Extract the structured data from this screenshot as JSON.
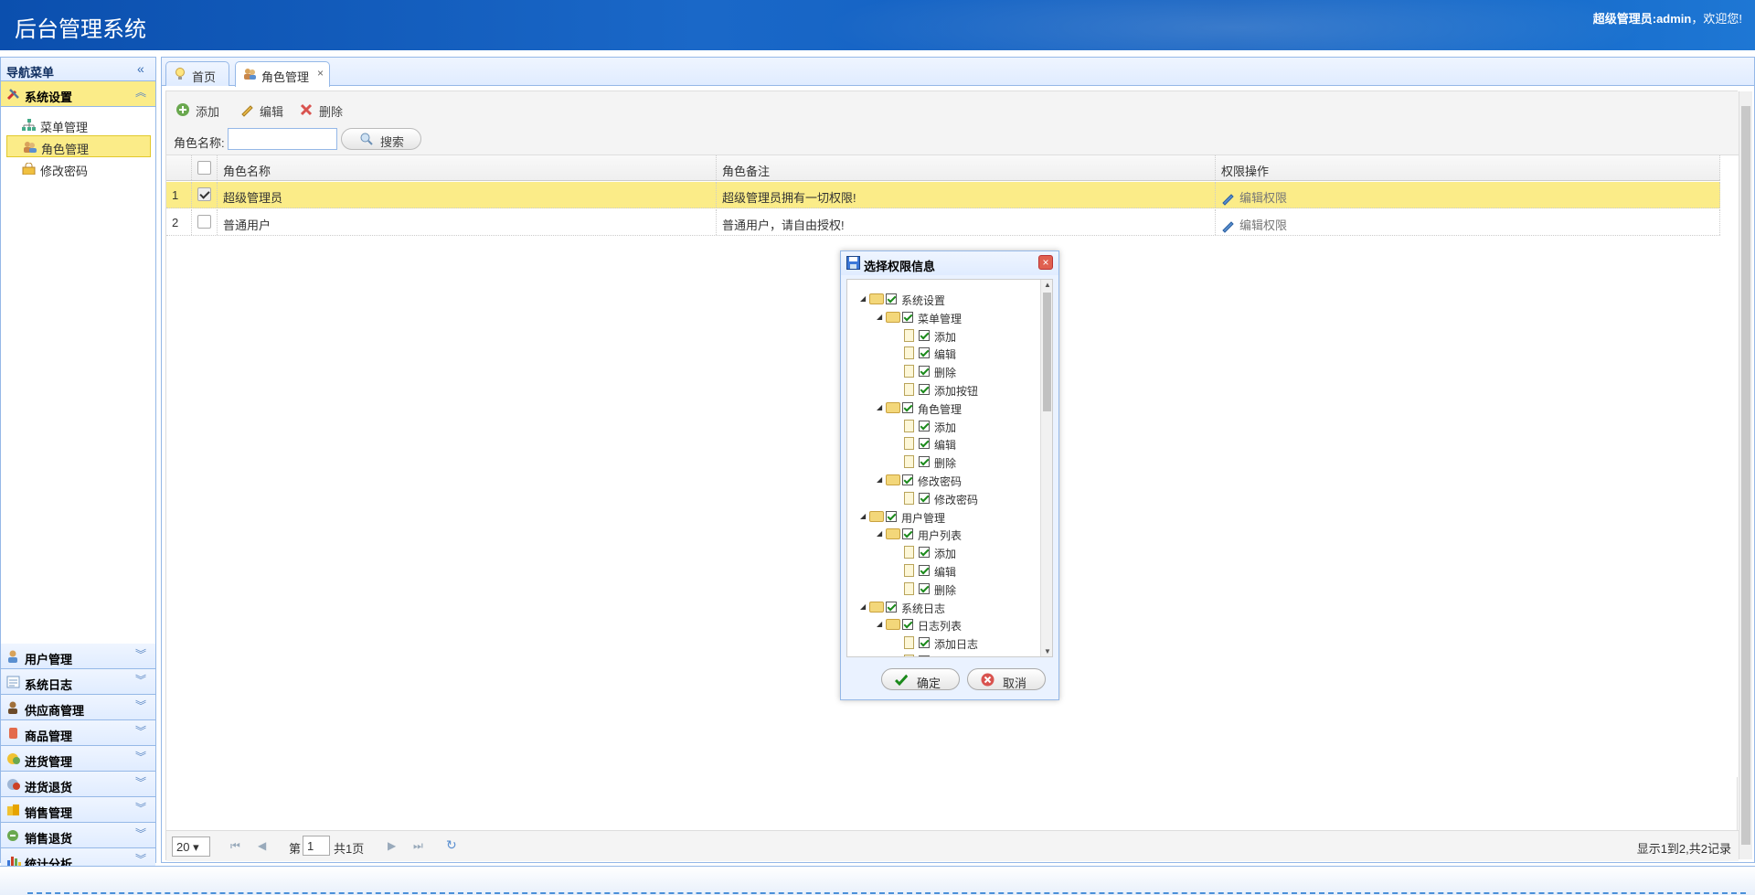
{
  "header": {
    "title": "后台管理系统",
    "welcome_user": "超级管理员:admin",
    "welcome_suffix": "，欢迎您!"
  },
  "sidebar": {
    "title": "导航菜单",
    "active_section": {
      "label": "系统设置",
      "items": [
        {
          "label": "菜单管理",
          "selected": false
        },
        {
          "label": "角色管理",
          "selected": true
        },
        {
          "label": "修改密码",
          "selected": false
        }
      ]
    },
    "sections": [
      {
        "label": "用户管理"
      },
      {
        "label": "系统日志"
      },
      {
        "label": "供应商管理"
      },
      {
        "label": "商品管理"
      },
      {
        "label": "进货管理"
      },
      {
        "label": "进货退货"
      },
      {
        "label": "销售管理"
      },
      {
        "label": "销售退货"
      },
      {
        "label": "统计分析"
      }
    ]
  },
  "tabs": [
    {
      "label": "首页"
    },
    {
      "label": "角色管理",
      "closable": "×"
    }
  ],
  "toolbar": {
    "add": "添加",
    "edit": "编辑",
    "delete": "删除",
    "search_label": "角色名称:",
    "search_placeholder": "",
    "search_button": "搜索"
  },
  "grid": {
    "columns": [
      "角色名称",
      "角色备注",
      "权限操作"
    ],
    "rows": [
      {
        "num": "1",
        "name": "超级管理员",
        "remark": "超级管理员拥有一切权限!",
        "action": "编辑权限",
        "checked": true
      },
      {
        "num": "2",
        "name": "普通用户",
        "remark": "普通用户，请自由授权!",
        "action": "编辑权限",
        "checked": false
      }
    ]
  },
  "pager": {
    "page_size": "20",
    "page_prefix": "第",
    "page_value": "1",
    "page_total": "共1页",
    "summary": "显示1到2,共2记录"
  },
  "dialog": {
    "title": "选择权限信息",
    "tree": [
      {
        "label": "系统设置",
        "level": 0,
        "type": "folder"
      },
      {
        "label": "菜单管理",
        "level": 1,
        "type": "folder"
      },
      {
        "label": "添加",
        "level": 2,
        "type": "file"
      },
      {
        "label": "编辑",
        "level": 2,
        "type": "file"
      },
      {
        "label": "删除",
        "level": 2,
        "type": "file"
      },
      {
        "label": "添加按钮",
        "level": 2,
        "type": "file"
      },
      {
        "label": "角色管理",
        "level": 1,
        "type": "folder"
      },
      {
        "label": "添加",
        "level": 2,
        "type": "file"
      },
      {
        "label": "编辑",
        "level": 2,
        "type": "file"
      },
      {
        "label": "删除",
        "level": 2,
        "type": "file"
      },
      {
        "label": "修改密码",
        "level": 1,
        "type": "folder"
      },
      {
        "label": "修改密码",
        "level": 2,
        "type": "file"
      },
      {
        "label": "用户管理",
        "level": 0,
        "type": "folder"
      },
      {
        "label": "用户列表",
        "level": 1,
        "type": "folder"
      },
      {
        "label": "添加",
        "level": 2,
        "type": "file"
      },
      {
        "label": "编辑",
        "level": 2,
        "type": "file"
      },
      {
        "label": "删除",
        "level": 2,
        "type": "file"
      },
      {
        "label": "系统日志",
        "level": 0,
        "type": "folder"
      },
      {
        "label": "日志列表",
        "level": 1,
        "type": "folder"
      },
      {
        "label": "添加日志",
        "level": 2,
        "type": "file"
      },
      {
        "label": "删除",
        "level": 2,
        "type": "file"
      }
    ],
    "ok": "确定",
    "cancel": "取消"
  },
  "colors": {
    "header_blue": "#0b4fae",
    "selected_yellow": "#fbec88",
    "border_blue": "#95b8e7",
    "check_green": "#1b8a1b"
  }
}
